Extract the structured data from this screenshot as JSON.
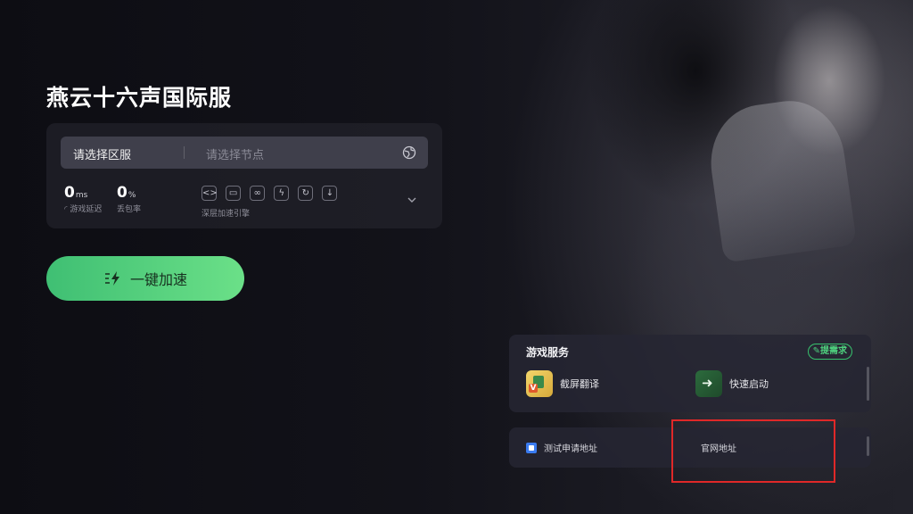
{
  "game": {
    "title": "燕云十六声国际服"
  },
  "server_panel": {
    "region_label": "请选择区服",
    "node_placeholder": "请选择节点",
    "latency": {
      "value": "0",
      "unit": "ms",
      "label": "游戏延迟"
    },
    "packet_loss": {
      "value": "0",
      "unit": "%",
      "label": "丢包率"
    },
    "engine_label": "深层加速引擎",
    "engine_icons": [
      "code-icon",
      "screen-icon",
      "link-icon",
      "bolt-icon",
      "refresh-icon",
      "download-icon"
    ]
  },
  "accelerate_button": {
    "label": "一键加速"
  },
  "services": {
    "title": "游戏服务",
    "request_label": "提需求",
    "items": [
      {
        "label": "截屏翻译",
        "icon": "translate-app-icon"
      },
      {
        "label": "快速启动",
        "icon": "quick-launch-icon"
      }
    ]
  },
  "links": {
    "items": [
      {
        "label": "测试申请地址",
        "icon": "test-apply-icon"
      },
      {
        "label": "官网地址"
      }
    ]
  },
  "colors": {
    "accent_green": "#4fd27f",
    "highlight_red": "#e02828"
  }
}
